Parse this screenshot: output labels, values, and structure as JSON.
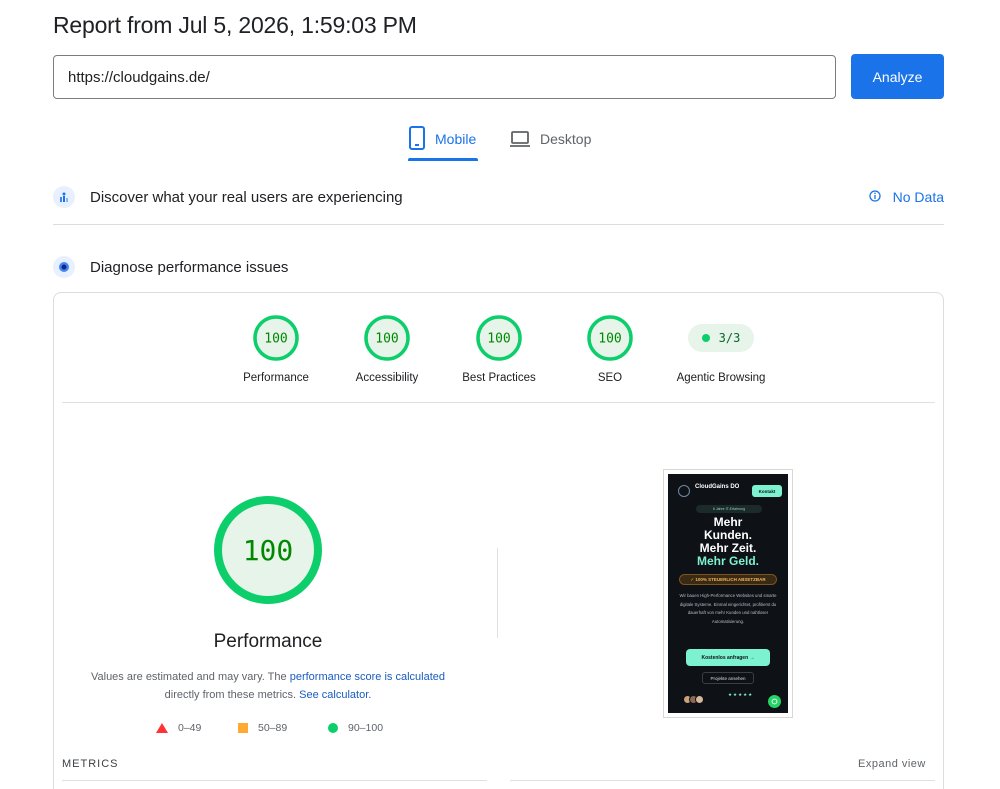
{
  "header": {
    "title": "Report from Jul 5, 2026, 1:59:03 PM"
  },
  "url_input": {
    "value": "https://cloudgains.de/",
    "placeholder": ""
  },
  "analyze_button": {
    "label": "Analyze"
  },
  "tabs": [
    {
      "label": "Mobile",
      "icon": "smartphone-icon",
      "active": true
    },
    {
      "label": "Desktop",
      "icon": "laptop-icon",
      "active": false
    }
  ],
  "field_data": {
    "title": "Discover what your real users are experiencing",
    "status": "No Data"
  },
  "diagnose": {
    "title": "Diagnose performance issues"
  },
  "scores": [
    {
      "value": "100",
      "label": "Performance"
    },
    {
      "value": "100",
      "label": "Accessibility"
    },
    {
      "value": "100",
      "label": "Best Practices"
    },
    {
      "value": "100",
      "label": "SEO"
    }
  ],
  "agentic": {
    "value": "3/3",
    "label": "Agentic Browsing"
  },
  "performance": {
    "score": "100",
    "title": "Performance",
    "desc_1": "Values are estimated and may vary. The ",
    "desc_link_1": "performance score is calculated",
    "desc_2": "directly from these metrics.",
    "desc_link_2": "See calculator."
  },
  "legend": [
    {
      "range": "0–49",
      "color": "#ff3333"
    },
    {
      "range": "50–89",
      "color": "#ffaa33"
    },
    {
      "range": "90–100",
      "color": "#0cce6b"
    }
  ],
  "screenshot": {
    "brand": "CloudGains DO",
    "contact": "Kontakt",
    "badge": "6 Jahre IT-Erfahrung",
    "headline_1": "Mehr",
    "headline_2": "Kunden.",
    "headline_3": "Mehr Zeit.",
    "headline_4": "Mehr Geld.",
    "tax": "✓ 100% STEUERLICH ABSETZBAR",
    "body": "Wir bauen High-Performance Websites und smarte digitale Systeme. Einmal eingerichtet, profitierst du dauerhaft von mehr Kunden und nahtloser Automatisierung.",
    "cta": "Kostenlos anfragen →",
    "projects": "Projekte ansehen",
    "stars": "★★★★★"
  },
  "metrics": {
    "label": "METRICS",
    "expand": "Expand view"
  },
  "colors": {
    "accent": "#1a73e8",
    "pass": "#0cce6b",
    "pass_text": "#008800",
    "pass_bg": "#e6f4ea"
  }
}
